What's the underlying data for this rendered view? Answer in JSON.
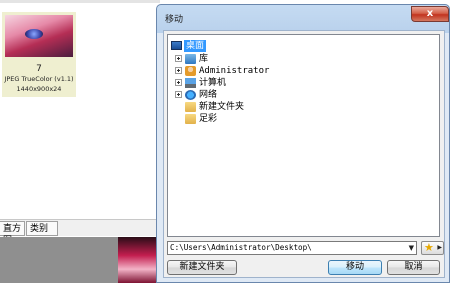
{
  "background_app": {
    "thumbnail": {
      "number": "7",
      "format": "JPEG TrueColor (v1.1)",
      "dimensions": "1440x900x24"
    },
    "tabs": [
      "直方图",
      "类别"
    ]
  },
  "dialog": {
    "title": "移动",
    "close_label": "x",
    "tree": {
      "root": "桌面",
      "items": [
        {
          "label": "库",
          "icon": "library-icon"
        },
        {
          "label": "Administrator",
          "icon": "user-folder-icon"
        },
        {
          "label": "计算机",
          "icon": "computer-icon"
        },
        {
          "label": "网络",
          "icon": "network-icon"
        },
        {
          "label": "新建文件夹",
          "icon": "folder-icon"
        },
        {
          "label": "足彩",
          "icon": "folder-icon"
        }
      ]
    },
    "path": "C:\\Users\\Administrator\\Desktop\\",
    "buttons": {
      "new_folder": "新建文件夹",
      "move": "移动",
      "cancel": "取消"
    }
  }
}
